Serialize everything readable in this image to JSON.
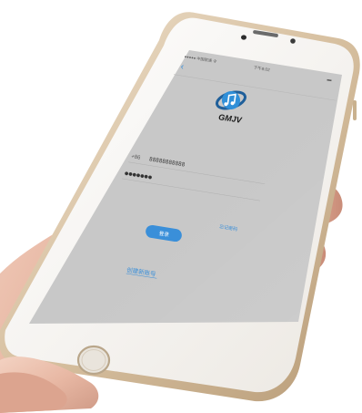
{
  "status_bar": {
    "carrier": "●●●●● 中国联通 令",
    "time": "下午8:02",
    "battery": "▬"
  },
  "nav": {
    "back_glyph": "‹"
  },
  "logo": {
    "text": "GMJV",
    "colors": {
      "ring": "#2f8fd8",
      "ring_dark": "#1f5f9a"
    }
  },
  "login_form": {
    "country_code": "+86",
    "phone_value": "88888888888",
    "password_value": "●●●●●●●",
    "login_button_label": "登录",
    "forgot_password_link": "忘记密码",
    "create_account_link": "创建新账号"
  },
  "colors": {
    "screen_bg": "#c9c9c9",
    "accent": "#3a8fd9",
    "phone_body": "#f4f0ea",
    "phone_rim": "#dcc8ac"
  }
}
